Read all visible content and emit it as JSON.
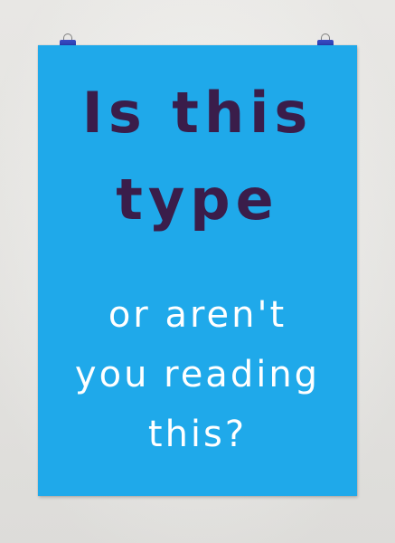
{
  "poster": {
    "lines": [
      "Is this",
      "type",
      "or aren't",
      "you reading",
      "this?"
    ],
    "background_color": "#1fa9ea",
    "headline_color": "#3a1d4a",
    "subline_color": "#ffffff"
  },
  "clips": [
    "binder-clip-icon",
    "binder-clip-icon"
  ]
}
